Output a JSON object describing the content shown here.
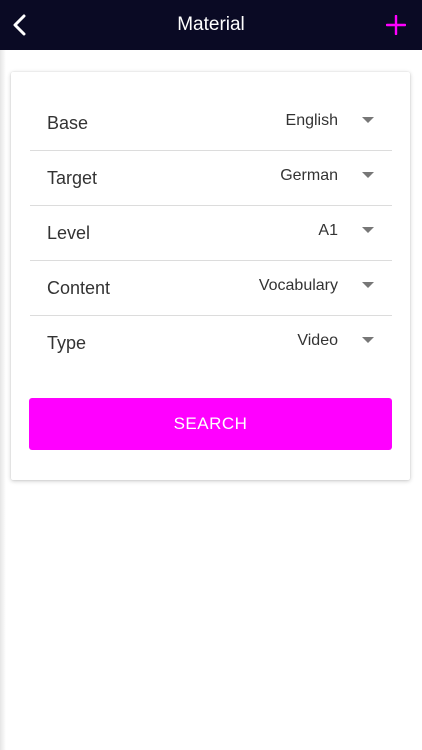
{
  "header": {
    "title": "Material",
    "back_icon": "chevron-left-icon",
    "add_icon": "plus-icon",
    "background_color": "#0a0a24",
    "accent_color": "#ff00ff"
  },
  "form": {
    "fields": [
      {
        "label": "Base",
        "value": "English"
      },
      {
        "label": "Target",
        "value": "German"
      },
      {
        "label": "Level",
        "value": "A1"
      },
      {
        "label": "Content",
        "value": "Vocabulary"
      },
      {
        "label": "Type",
        "value": "Video"
      }
    ],
    "dropdown_icon": "caret-down-icon",
    "search_label": "SEARCH",
    "search_color": "#ff00ff"
  }
}
